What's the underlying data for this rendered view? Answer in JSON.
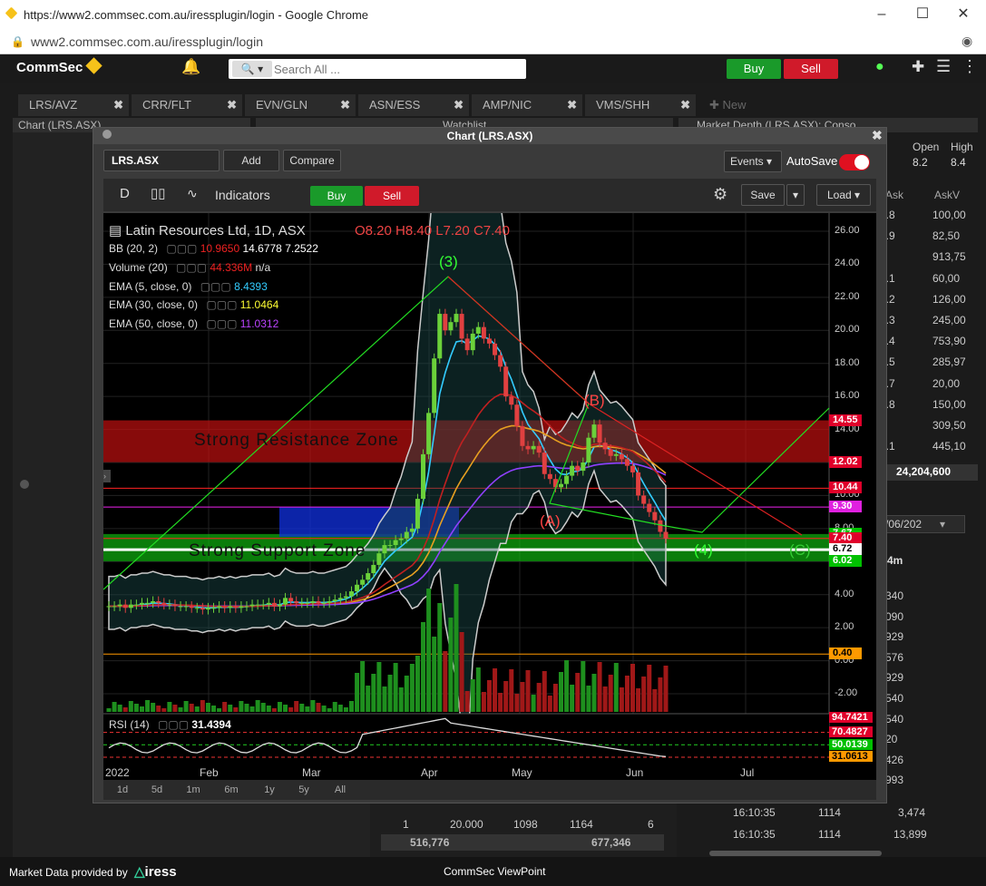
{
  "browser": {
    "title": "https://www2.commsec.com.au/iressplugin/login - Google Chrome",
    "url": "www2.commsec.com.au/iressplugin/login"
  },
  "app": {
    "logo": "CommSec",
    "search_placeholder": "Search All ...",
    "buy": "Buy",
    "sell": "Sell"
  },
  "tabs": [
    "LRS/AVZ",
    "CRR/FLT",
    "EVN/GLN",
    "ASN/ESS",
    "AMP/NIC",
    "VMS/SHH",
    "New"
  ],
  "panels": {
    "chart": "Chart (LRS.ASX)",
    "watchlist": "Watchlist",
    "depth": "Market Depth (LRS.ASX): Conso..."
  },
  "chartwin": {
    "title": "Chart (LRS.ASX)",
    "symbol": "LRS.ASX",
    "add": "Add",
    "compare": "Compare",
    "events": "Events",
    "autosave": "AutoSave",
    "period": "D",
    "indicators": "Indicators",
    "buy": "Buy",
    "sell": "Sell",
    "save": "Save",
    "load": "Load"
  },
  "legend": {
    "name": "Latin Resources Ltd, 1D, ASX",
    "ohlc": {
      "o": "O8.20",
      "h": "H8.40",
      "l": "L7.20",
      "c": "C7.40"
    },
    "bb": {
      "label": "BB (20, 2)",
      "v1": "10.9650",
      "v2": "14.6778",
      "v3": "7.2522"
    },
    "vol": {
      "label": "Volume (20)",
      "v1": "44.336M",
      "v2": "n/a"
    },
    "ema5": {
      "label": "EMA (5, close, 0)",
      "v": "8.4393"
    },
    "ema30": {
      "label": "EMA (30, close, 0)",
      "v": "11.0464"
    },
    "ema50": {
      "label": "EMA (50, close, 0)",
      "v": "11.0312"
    },
    "rsi": {
      "label": "RSI (14)",
      "v": "31.4394"
    }
  },
  "annotations": {
    "resistance": "Strong Resistance Zone",
    "support": "Strong Support Zone",
    "w3": "(3)",
    "wB": "(B)",
    "wA": "(A)",
    "w4": "(4)",
    "wC": "(C)"
  },
  "price_axis": [
    "26.00",
    "24.00",
    "22.00",
    "20.00",
    "18.00",
    "16.00",
    "14.00",
    "12.00",
    "10.00",
    "8.00",
    "6.00",
    "4.00",
    "2.00",
    "0.00",
    "-2.00"
  ],
  "price_tags": [
    {
      "v": "14.55",
      "bg": "#e0002a",
      "fg": "#fff"
    },
    {
      "v": "12.02",
      "bg": "#e0002a",
      "fg": "#fff"
    },
    {
      "v": "10.44",
      "bg": "#e0002a",
      "fg": "#fff"
    },
    {
      "v": "9.30",
      "bg": "#e020e0",
      "fg": "#fff"
    },
    {
      "v": "7.67",
      "bg": "#00c000",
      "fg": "#fff"
    },
    {
      "v": "7.40",
      "bg": "#e0002a",
      "fg": "#fff"
    },
    {
      "v": "6.72",
      "bg": "#ffffff",
      "fg": "#000"
    },
    {
      "v": "6.02",
      "bg": "#00c000",
      "fg": "#fff"
    },
    {
      "v": "0.40",
      "bg": "#ff9900",
      "fg": "#000"
    }
  ],
  "rsi_tags": [
    {
      "v": "94.7421",
      "bg": "#e0002a",
      "fg": "#fff"
    },
    {
      "v": "70.4827",
      "bg": "#e0002a",
      "fg": "#fff"
    },
    {
      "v": "50.0139",
      "bg": "#00c000",
      "fg": "#fff"
    },
    {
      "v": "31.0613",
      "bg": "#ff9900",
      "fg": "#000"
    }
  ],
  "x_axis": [
    "2022",
    "Feb",
    "Mar",
    "Apr",
    "May",
    "Jun",
    "Jul"
  ],
  "periods": [
    "1d",
    "5d",
    "1m",
    "6m",
    "1y",
    "5y",
    "All"
  ],
  "depth": {
    "header": {
      "open": "Open",
      "high": "High",
      "open_v": "8.2",
      "high_v": "8.4",
      "ask": "Ask",
      "askv": "AskV"
    },
    "rows": [
      [
        "7.8",
        "100,00"
      ],
      [
        "7.9",
        "82,50"
      ],
      [
        "8",
        "913,75"
      ],
      [
        "8.1",
        "60,00"
      ],
      [
        "8.2",
        "126,00"
      ],
      [
        "8.3",
        "245,00"
      ],
      [
        "8.4",
        "753,90"
      ],
      [
        "8.5",
        "285,97"
      ],
      [
        "8.7",
        "20,00"
      ],
      [
        "8.8",
        "150,00"
      ],
      [
        "9",
        "309,50"
      ],
      [
        "9.1",
        "445,10"
      ]
    ],
    "total": "24,204,600",
    "date": "/06/202",
    "course_hdr": "4m",
    "course_rows": [
      "340",
      "090",
      "929",
      "576",
      "929",
      "540",
      "540",
      "20",
      "426",
      "993"
    ],
    "trades": [
      [
        "16:10:35",
        "1114",
        "3,474"
      ],
      [
        "16:10:35",
        "1114",
        "13,899"
      ]
    ]
  },
  "watchlist_footer": {
    "row": [
      "1",
      "20.000",
      "1098",
      "1164",
      "6"
    ],
    "totals": [
      "516,776",
      "677,346"
    ]
  },
  "footer": {
    "provided": "Market Data provided by",
    "brand": "iress",
    "center": "CommSec ViewPoint"
  },
  "chart_data": {
    "type": "candlestick",
    "title": "Latin Resources Ltd, 1D, ASX",
    "ylim": [
      -3,
      27
    ],
    "x_labels": [
      "2022",
      "Feb",
      "Mar",
      "Apr",
      "May",
      "Jun",
      "Jul"
    ],
    "close": [
      3.3,
      3.3,
      3.4,
      3.2,
      3.4,
      3.4,
      3.5,
      3.5,
      3.6,
      3.5,
      3.4,
      3.4,
      3.3,
      3.3,
      3.3,
      3.2,
      3.2,
      3.1,
      3.2,
      3.2,
      3.3,
      3.2,
      3.3,
      3.2,
      3.3,
      3.3,
      3.4,
      3.4,
      3.4,
      3.5,
      3.3,
      3.4,
      3.8,
      3.6,
      3.5,
      3.5,
      3.5,
      3.6,
      3.5,
      3.5,
      3.6,
      3.7,
      3.8,
      3.9,
      4.2,
      4.6,
      4.9,
      5.3,
      5.8,
      6.5,
      7.0,
      7.0,
      7.3,
      7.4,
      7.8,
      8.0,
      9.8,
      12.5,
      15.0,
      18.3,
      21.0,
      20.0,
      20.5,
      21.0,
      19.5,
      18.8,
      19.8,
      20.2,
      19.5,
      19.2,
      18.5,
      17.8,
      16.0,
      15.5,
      14.2,
      13.0,
      12.8,
      13.0,
      12.6,
      11.3,
      11.0,
      10.5,
      10.7,
      11.2,
      11.8,
      11.5,
      12.0,
      13.5,
      14.3,
      13.2,
      12.8,
      12.4,
      12.5,
      12.2,
      11.8,
      11.4,
      10.0,
      9.5,
      9.0,
      8.5,
      7.8,
      7.4
    ],
    "ema5": 8.4393,
    "ema30": 11.0464,
    "ema50": 11.0312,
    "rsi": 31.4394,
    "zones": {
      "resistance": [
        12.02,
        14.55
      ],
      "support": [
        6.02,
        7.67
      ]
    }
  }
}
